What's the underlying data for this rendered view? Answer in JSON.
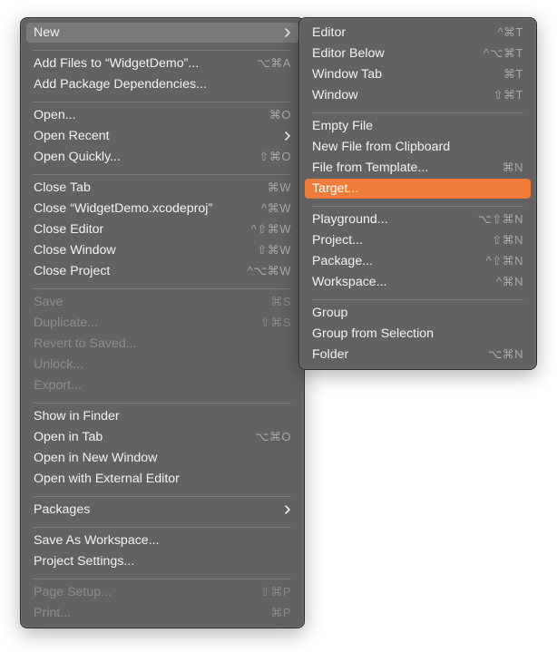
{
  "main_menu": {
    "new": {
      "label": "New"
    },
    "add_files": {
      "label": "Add Files to “WidgetDemo”...",
      "shortcut": "⌥⌘A"
    },
    "add_package": {
      "label": "Add Package Dependencies..."
    },
    "open": {
      "label": "Open...",
      "shortcut": "⌘O"
    },
    "open_recent": {
      "label": "Open Recent"
    },
    "open_quickly": {
      "label": "Open Quickly...",
      "shortcut": "⇧⌘O"
    },
    "close_tab": {
      "label": "Close Tab",
      "shortcut": "⌘W"
    },
    "close_project_file": {
      "label": "Close “WidgetDemo.xcodeproj”",
      "shortcut": "^⌘W"
    },
    "close_editor": {
      "label": "Close Editor",
      "shortcut": "^⇧⌘W"
    },
    "close_window": {
      "label": "Close Window",
      "shortcut": "⇧⌘W"
    },
    "close_project": {
      "label": "Close Project",
      "shortcut": "^⌥⌘W"
    },
    "save": {
      "label": "Save",
      "shortcut": "⌘S"
    },
    "duplicate": {
      "label": "Duplicate...",
      "shortcut": "⇧⌘S"
    },
    "revert": {
      "label": "Revert to Saved..."
    },
    "unlock": {
      "label": "Unlock..."
    },
    "export": {
      "label": "Export..."
    },
    "show_in_finder": {
      "label": "Show in Finder"
    },
    "open_in_tab": {
      "label": "Open in Tab",
      "shortcut": "⌥⌘O"
    },
    "open_new_window": {
      "label": "Open in New Window"
    },
    "open_external": {
      "label": "Open with External Editor"
    },
    "packages": {
      "label": "Packages"
    },
    "save_workspace": {
      "label": "Save As Workspace..."
    },
    "project_settings": {
      "label": "Project Settings..."
    },
    "page_setup": {
      "label": "Page Setup...",
      "shortcut": "⇧⌘P"
    },
    "print": {
      "label": "Print...",
      "shortcut": "⌘P"
    }
  },
  "sub_menu": {
    "editor": {
      "label": "Editor",
      "shortcut": "^⌘T"
    },
    "editor_below": {
      "label": "Editor Below",
      "shortcut": "^⌥⌘T"
    },
    "window_tab": {
      "label": "Window Tab",
      "shortcut": "⌘T"
    },
    "window": {
      "label": "Window",
      "shortcut": "⇧⌘T"
    },
    "empty_file": {
      "label": "Empty File"
    },
    "new_from_clipboard": {
      "label": "New File from Clipboard"
    },
    "file_from_template": {
      "label": "File from Template...",
      "shortcut": "⌘N"
    },
    "target": {
      "label": "Target..."
    },
    "playground": {
      "label": "Playground...",
      "shortcut": "⌥⇧⌘N"
    },
    "project": {
      "label": "Project...",
      "shortcut": "⇧⌘N"
    },
    "package": {
      "label": "Package...",
      "shortcut": "^⇧⌘N"
    },
    "workspace": {
      "label": "Workspace...",
      "shortcut": "^⌘N"
    },
    "group": {
      "label": "Group"
    },
    "group_from_selection": {
      "label": "Group from Selection"
    },
    "folder": {
      "label": "Folder",
      "shortcut": "⌥⌘N"
    }
  },
  "colors": {
    "menu_bg": "#626264",
    "selected_gray": "#7a7a7d",
    "selected_orange": "#ef7d3a",
    "text": "#f2f2f2",
    "disabled_text": "#8e8e90"
  }
}
